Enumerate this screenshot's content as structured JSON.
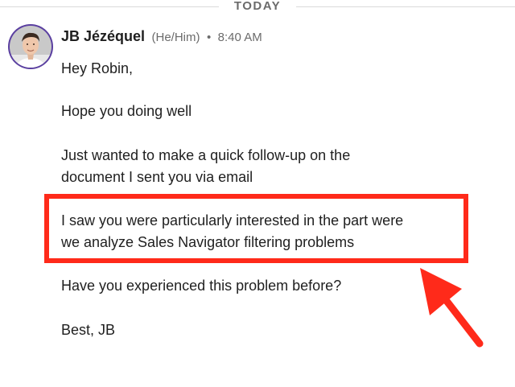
{
  "divider": {
    "label": "TODAY"
  },
  "message": {
    "sender_name": "JB Jézéquel",
    "pronouns": "(He/Him)",
    "separator": "•",
    "time": "8:40 AM",
    "paragraphs": [
      [
        "Hey Robin,"
      ],
      [
        "Hope you doing well"
      ],
      [
        "Just wanted to make a quick follow-up on the",
        "document I sent you via email"
      ],
      [
        "I saw you were particularly interested in the part were",
        "we analyze Sales Navigator filtering problems"
      ],
      [
        "Have you experienced this problem before?"
      ],
      [
        "Best, JB"
      ]
    ]
  },
  "annotation": {
    "color": "#ff2a1a"
  },
  "colors": {
    "avatar_ring": "#5a3fa0",
    "muted_text": "#6b6b6b"
  }
}
